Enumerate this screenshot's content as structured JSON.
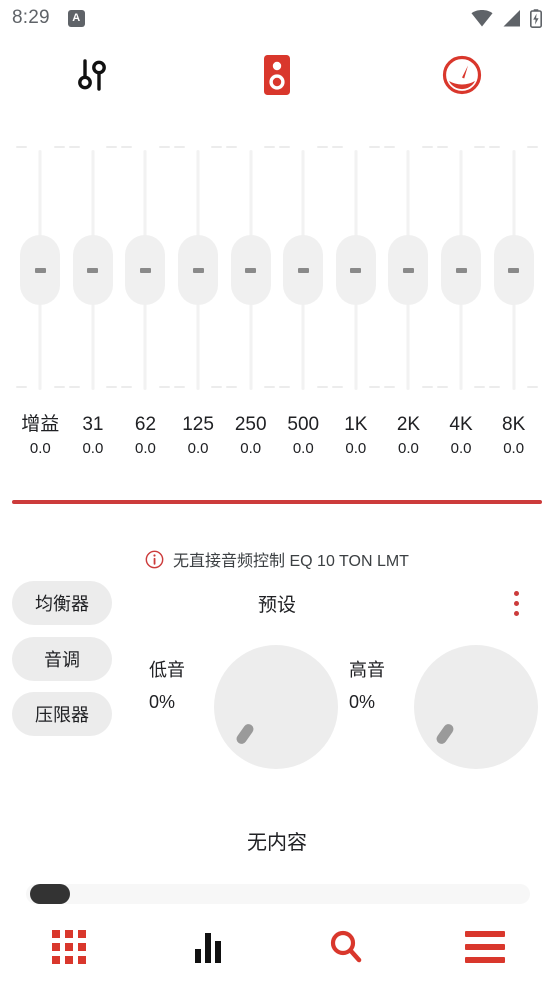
{
  "statusbar": {
    "time": "8:29",
    "badge_label": "A",
    "icons": [
      "wifi-icon",
      "cell-signal-icon",
      "battery-charging-icon"
    ]
  },
  "toolbar": {
    "items": [
      {
        "name": "tuner-sliders-icon",
        "color": "#111111"
      },
      {
        "name": "speaker-icon",
        "color": "#d9372c"
      },
      {
        "name": "gauge-icon",
        "color": "#d9372c"
      }
    ]
  },
  "equalizer": {
    "accent_color": "#cc3b3b",
    "bands": [
      {
        "label": "增益",
        "value": "0.0",
        "position_pct": 50
      },
      {
        "label": "31",
        "value": "0.0",
        "position_pct": 50
      },
      {
        "label": "62",
        "value": "0.0",
        "position_pct": 50
      },
      {
        "label": "125",
        "value": "0.0",
        "position_pct": 50
      },
      {
        "label": "250",
        "value": "0.0",
        "position_pct": 50
      },
      {
        "label": "500",
        "value": "0.0",
        "position_pct": 50
      },
      {
        "label": "1K",
        "value": "0.0",
        "position_pct": 50
      },
      {
        "label": "2K",
        "value": "0.0",
        "position_pct": 50
      },
      {
        "label": "4K",
        "value": "0.0",
        "position_pct": 50
      },
      {
        "label": "8K",
        "value": "0.0",
        "position_pct": 50
      }
    ]
  },
  "info": {
    "icon": "info-circle-icon",
    "text": "无直接音频控制 EQ 10 TON LMT",
    "color": "#cc3b3b"
  },
  "mode_buttons": [
    {
      "label": "均衡器"
    },
    {
      "label": "音调"
    },
    {
      "label": "压限器"
    }
  ],
  "preset": {
    "label": "预设",
    "menu_icon": "kebab-menu-icon"
  },
  "knobs": [
    {
      "label": "低音",
      "value": "0%"
    },
    {
      "label": "高音",
      "value": "0%"
    }
  ],
  "content": {
    "empty_text": "无内容"
  },
  "seekbar": {
    "thumb_position_pct": 1
  },
  "bottomnav": {
    "items": [
      {
        "name": "grid-apps-icon",
        "color": "#d9372c"
      },
      {
        "name": "equalizer-bars-icon",
        "color": "#111111"
      },
      {
        "name": "search-icon",
        "color": "#d9372c"
      },
      {
        "name": "hamburger-menu-icon",
        "color": "#d9372c"
      }
    ]
  }
}
